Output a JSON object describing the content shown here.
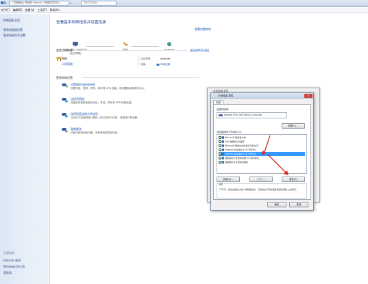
{
  "addressbar": {
    "path": "▸ 控制面板 ▸ 网络和 Internet ▸ 网络和共享中心",
    "search_placeholder": "搜索控制面板"
  },
  "menu": [
    "文件(F)",
    "编辑(E)",
    "查看(V)",
    "工具(T)",
    "帮助(H)"
  ],
  "sidebar": {
    "items": [
      "控制面板主页",
      "更改适配器设置",
      "更改高级共享设置"
    ],
    "see_also_title": "另请参阅",
    "see_also": [
      "Internet 选项",
      "Windows 防火墙",
      "家庭组"
    ]
  },
  "main": {
    "title": "查看基本网络信息并设置连接",
    "full_map": "查看完整映射",
    "nodes": [
      "WIN-2R7C1HA6I7H\n(此计算机)",
      "网络",
      "Internet"
    ],
    "active_header": "查看活动网络",
    "connect_link": "连接或断开连接",
    "network_name": "网络",
    "network_type": "公用网络",
    "access_label": "访问类型:",
    "access_value": "Internet",
    "conn_label": "连接:",
    "conn_value": "本地连接",
    "change_header": "更改网络设置",
    "tasks": [
      {
        "title": "设置新的连接或网络",
        "desc": "设置无线、宽带、拨号、临时或 VPN 连接；或设置路由器或访问点。"
      },
      {
        "title": "连接到网络",
        "desc": "连接到或重新连接到无线、有线、拨号或 VPN 网络连接。"
      },
      {
        "title": "选择家庭组和共享选项",
        "desc": "访问位于其他网络计算机上的文件和打印机，或更改共享设置。"
      },
      {
        "title": "疑难解答",
        "desc": "诊断并修复网络问题，或获得故障排除信息。"
      }
    ]
  },
  "back_window": {
    "title": "本地连接 状态"
  },
  "dialog": {
    "title": "本地连接 属性",
    "close": "×",
    "tab": "网络",
    "connect_using": "连接时使用:",
    "adapter": "Realtek PCIe GBE Family Controller",
    "configure": "配置(C)...",
    "items_label": "此连接使用下列项目(O):",
    "items": [
      {
        "label": "Microsoft 网络客户端",
        "checked": true
      },
      {
        "label": "QoS 数据包计划程序",
        "checked": true
      },
      {
        "label": "Microsoft 网络的文件和打印机共享",
        "checked": true
      },
      {
        "label": "Internet 协议版本 6 (TCP/IPv6)",
        "checked": true
      },
      {
        "label": "Internet 协议版本 4 (TCP/IPv4)",
        "checked": true
      },
      {
        "label": "链路层拓扑发现映射器 I/O 驱动程序",
        "checked": true
      },
      {
        "label": "链路层拓扑发现响应程序",
        "checked": true
      }
    ],
    "install": "安装(N)...",
    "uninstall": "卸载(U)",
    "properties": "属性(R)",
    "desc_title": "描述",
    "desc_text": "TCP/IP。该协议是默认的广域网络协议，它提供在不同的相互连接的网络上的通讯。",
    "ok": "确定",
    "cancel": "取消"
  },
  "colors": {
    "link": "#1a56b5",
    "title": "#1e3e9a",
    "selection": "#3399ff",
    "annotation_arrow": "#d9261c"
  }
}
